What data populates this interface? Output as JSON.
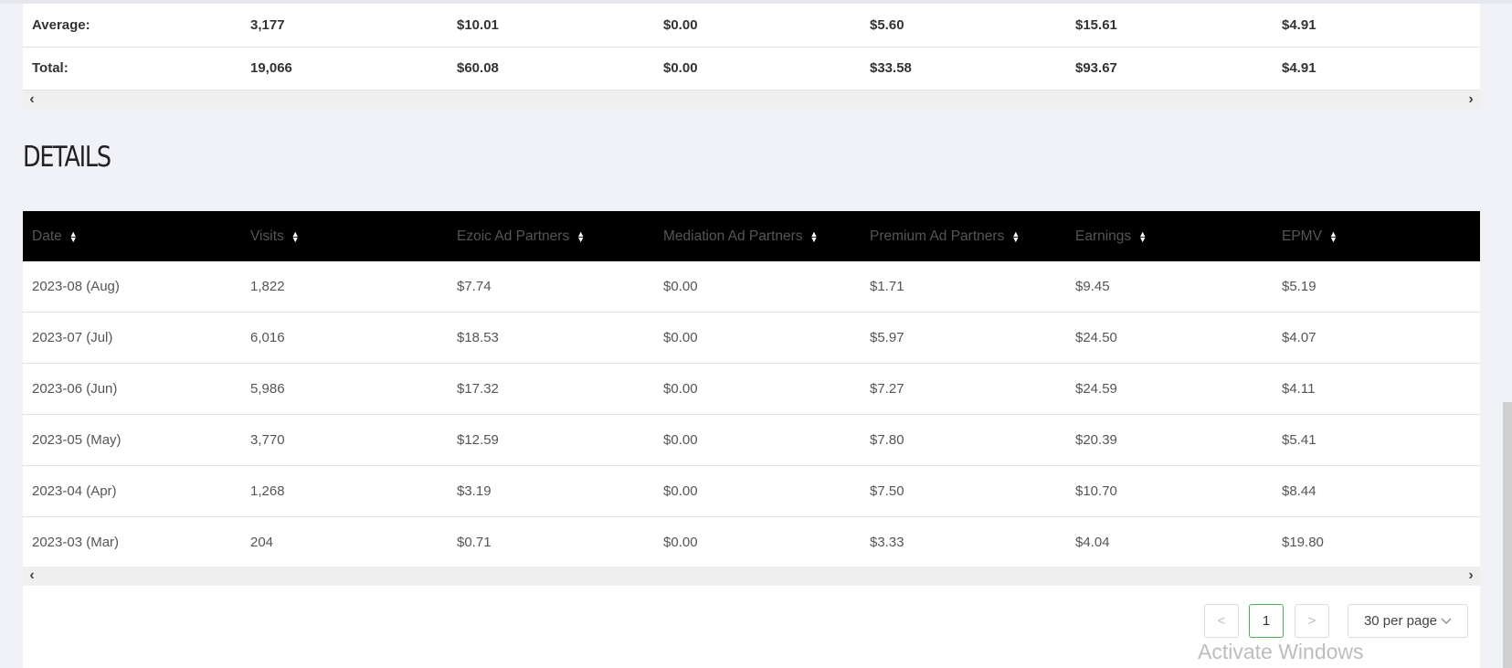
{
  "summary": {
    "rows": [
      {
        "label": "Average:",
        "visits": "3,177",
        "ezoic": "$10.01",
        "mediation": "$0.00",
        "premium": "$5.60",
        "earnings": "$15.61",
        "epmv": "$4.91"
      },
      {
        "label": "Total:",
        "visits": "19,066",
        "ezoic": "$60.08",
        "mediation": "$0.00",
        "premium": "$33.58",
        "earnings": "$93.67",
        "epmv": "$4.91"
      }
    ]
  },
  "scrollbar": {
    "left_arrow": "‹",
    "right_arrow": "›"
  },
  "details": {
    "title": "DETAILS",
    "columns": [
      "Date",
      "Visits",
      "Ezoic Ad Partners",
      "Mediation Ad Partners",
      "Premium Ad Partners",
      "Earnings",
      "EPMV"
    ],
    "rows": [
      [
        "2023-08 (Aug)",
        "1,822",
        "$7.74",
        "$0.00",
        "$1.71",
        "$9.45",
        "$5.19"
      ],
      [
        "2023-07 (Jul)",
        "6,016",
        "$18.53",
        "$0.00",
        "$5.97",
        "$24.50",
        "$4.07"
      ],
      [
        "2023-06 (Jun)",
        "5,986",
        "$17.32",
        "$0.00",
        "$7.27",
        "$24.59",
        "$4.11"
      ],
      [
        "2023-05 (May)",
        "3,770",
        "$12.59",
        "$0.00",
        "$7.80",
        "$20.39",
        "$5.41"
      ],
      [
        "2023-04 (Apr)",
        "1,268",
        "$3.19",
        "$0.00",
        "$7.50",
        "$10.70",
        "$8.44"
      ],
      [
        "2023-03 (Mar)",
        "204",
        "$0.71",
        "$0.00",
        "$3.33",
        "$4.04",
        "$19.80"
      ]
    ]
  },
  "pagination": {
    "prev": "<",
    "current": "1",
    "next": ">",
    "per_page": "30 per page",
    "dropdown_icon": "chevron-down"
  },
  "watermark": "Activate Windows"
}
